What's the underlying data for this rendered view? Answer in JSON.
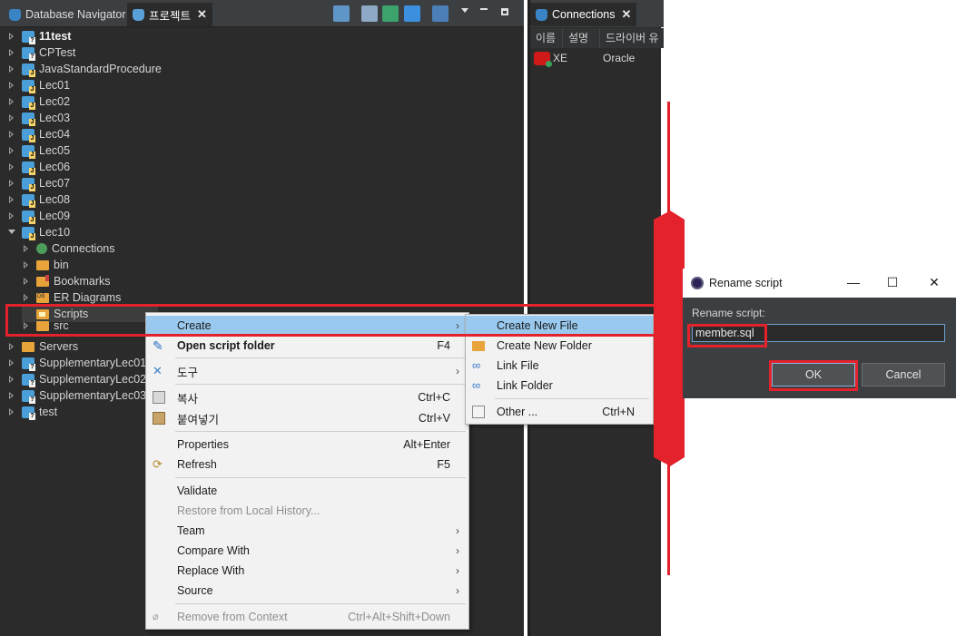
{
  "left_pane": {
    "tabs": [
      {
        "label": "Database Navigator"
      },
      {
        "label": "프로젝트"
      }
    ],
    "tree": [
      {
        "label": "11test",
        "bold": true,
        "icon": "project-icon"
      },
      {
        "label": "CPTest",
        "icon": "project-icon"
      },
      {
        "label": "JavaStandardProcedure",
        "icon": "java-project-icon"
      },
      {
        "label": "Lec01",
        "icon": "java-project-icon"
      },
      {
        "label": "Lec02",
        "icon": "java-project-icon"
      },
      {
        "label": "Lec03",
        "icon": "java-project-icon"
      },
      {
        "label": "Lec04",
        "icon": "java-project-icon"
      },
      {
        "label": "Lec05",
        "icon": "java-project-icon"
      },
      {
        "label": "Lec06",
        "icon": "java-project-icon"
      },
      {
        "label": "Lec07",
        "icon": "java-project-icon"
      },
      {
        "label": "Lec08",
        "icon": "java-project-icon"
      },
      {
        "label": "Lec09",
        "icon": "java-project-icon"
      },
      {
        "label": "Lec10",
        "icon": "java-project-icon",
        "expanded": true
      },
      {
        "label": "Connections",
        "icon": "connections-icon"
      },
      {
        "label": "bin",
        "icon": "folder-icon"
      },
      {
        "label": "Bookmarks",
        "icon": "bookmarks-icon"
      },
      {
        "label": "ER Diagrams",
        "icon": "er-diagrams-icon"
      },
      {
        "label": "Scripts",
        "icon": "scripts-folder-icon"
      },
      {
        "label": "src",
        "icon": "folder-icon"
      },
      {
        "label": "Servers",
        "icon": "folder-icon"
      },
      {
        "label": "SupplementaryLec01",
        "icon": "project-icon"
      },
      {
        "label": "SupplementaryLec02",
        "icon": "project-icon"
      },
      {
        "label": "SupplementaryLec03",
        "icon": "project-icon"
      },
      {
        "label": "test",
        "icon": "project-icon"
      }
    ]
  },
  "connections_pane": {
    "tab_label": "Connections",
    "columns": [
      "이름",
      "설명",
      "드라이버 유"
    ],
    "rows": [
      {
        "name": "XE",
        "description": "",
        "driver": "Oracle"
      }
    ]
  },
  "context_menu": {
    "items": [
      {
        "label": "Create",
        "shortcut": "",
        "submenu": true,
        "highlighted": true
      },
      {
        "label": "Open script folder",
        "shortcut": "F4",
        "bold": true
      },
      {
        "label": "도구",
        "submenu": true
      },
      {
        "label": "복사",
        "shortcut": "Ctrl+C"
      },
      {
        "label": "붙여넣기",
        "shortcut": "Ctrl+V"
      },
      {
        "label": "Properties",
        "shortcut": "Alt+Enter"
      },
      {
        "label": "Refresh",
        "shortcut": "F5"
      },
      {
        "label": "Validate"
      },
      {
        "label": "Restore from Local History...",
        "disabled": true
      },
      {
        "label": "Team",
        "submenu": true
      },
      {
        "label": "Compare With",
        "submenu": true
      },
      {
        "label": "Replace With",
        "submenu": true
      },
      {
        "label": "Source",
        "submenu": true
      },
      {
        "label": "Remove from Context",
        "shortcut": "Ctrl+Alt+Shift+Down",
        "disabled": true
      }
    ]
  },
  "create_submenu": {
    "items": [
      {
        "label": "Create New File",
        "highlighted": true
      },
      {
        "label": "Create New Folder"
      },
      {
        "label": "Link File"
      },
      {
        "label": "Link Folder"
      },
      {
        "label": "Other ...",
        "shortcut": "Ctrl+N"
      }
    ]
  },
  "rename_dialog": {
    "title": "Rename script",
    "label": "Rename script:",
    "value": "member.sql",
    "ok_label": "OK",
    "cancel_label": "Cancel"
  },
  "colors": {
    "highlight": "#e3222c",
    "menu_hover": "#99c9ef",
    "dark_bg": "#2b2b2b"
  }
}
